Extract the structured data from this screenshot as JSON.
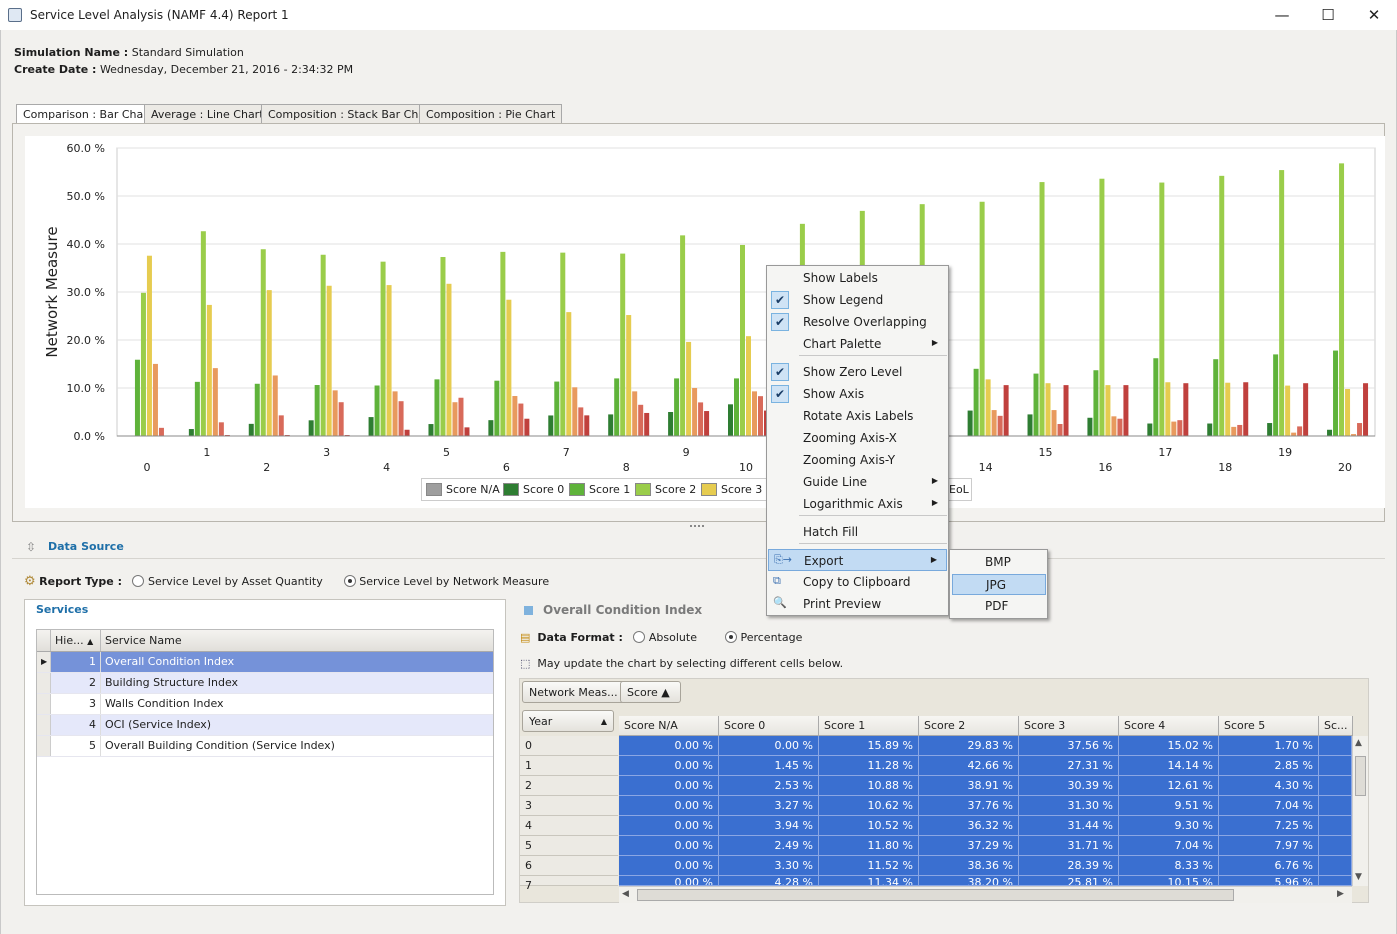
{
  "window": {
    "title": "Service Level Analysis (NAMF 4.4) Report 1",
    "minimize": "—",
    "maximize": "☐",
    "close": "✕"
  },
  "info": {
    "sim_label": "Simulation Name :",
    "sim_value": "Standard Simulation",
    "date_label": "Create Date :",
    "date_value": "Wednesday, December 21, 2016 - 2:34:32 PM"
  },
  "tabs": [
    "Comparison : Bar Chart",
    "Average : Line Chart",
    "Composition : Stack Bar Chart",
    "Composition : Pie Chart"
  ],
  "chart_data": {
    "type": "bar",
    "ylabel": "Network Measure",
    "ylim": [
      0,
      60
    ],
    "yticks": [
      "0.0 %",
      "10.0 %",
      "20.0 %",
      "30.0 %",
      "40.0 %",
      "50.0 %",
      "60.0 %"
    ],
    "categories": [
      "0",
      "1",
      "2",
      "3",
      "4",
      "5",
      "6",
      "7",
      "8",
      "9",
      "10",
      "11",
      "12",
      "13",
      "14",
      "15",
      "16",
      "17",
      "18",
      "19",
      "20"
    ],
    "legend_visible": [
      "Score N/A",
      "Score 0",
      "Score 1",
      "Score 2",
      "Score 3"
    ],
    "legend_tail": "EoL",
    "series": [
      {
        "name": "Score N/A",
        "color": "#9e9e9e",
        "values": [
          0,
          0,
          0,
          0,
          0,
          0,
          0,
          0,
          0,
          0,
          0,
          0,
          0,
          0,
          0,
          0,
          0,
          0,
          0,
          0,
          0
        ]
      },
      {
        "name": "Score 0",
        "color": "#2e7d32",
        "values": [
          0,
          1.45,
          2.53,
          3.27,
          3.94,
          2.49,
          3.3,
          4.28,
          4.5,
          5.0,
          6.6,
          5.5,
          5.5,
          5.5,
          5.3,
          4.5,
          3.8,
          2.6,
          2.6,
          2.7,
          1.3
        ]
      },
      {
        "name": "Score 1",
        "color": "#5fb33a",
        "values": [
          15.89,
          11.28,
          10.88,
          10.62,
          10.52,
          11.8,
          11.52,
          11.34,
          12,
          12,
          12,
          13,
          13,
          13,
          14,
          13,
          13.7,
          16.2,
          16,
          17,
          17.8
        ]
      },
      {
        "name": "Score 2",
        "color": "#9acd4a",
        "values": [
          29.83,
          42.66,
          38.91,
          37.76,
          36.32,
          37.29,
          38.36,
          38.2,
          38,
          41.8,
          39.8,
          44.2,
          46.9,
          48.3,
          48.8,
          52.9,
          53.6,
          52.8,
          54.2,
          55.4,
          56.8
        ]
      },
      {
        "name": "Score 3",
        "color": "#e6cc50",
        "values": [
          37.56,
          27.31,
          30.39,
          31.3,
          31.44,
          31.71,
          28.39,
          25.81,
          25.2,
          19.6,
          20.8,
          14,
          13,
          13,
          11.8,
          11,
          10.6,
          11.2,
          11.1,
          10.5,
          9.8
        ]
      },
      {
        "name": "Score 4",
        "color": "#e89a5e",
        "values": [
          15.02,
          14.14,
          12.61,
          9.51,
          9.3,
          7.04,
          8.33,
          10.15,
          9.3,
          10,
          9.3,
          7,
          6,
          6,
          5.4,
          5.4,
          4.1,
          3,
          1.9,
          0.7,
          0.4
        ]
      },
      {
        "name": "Score 5",
        "color": "#d86a5a",
        "values": [
          1.7,
          2.85,
          4.3,
          7.04,
          7.25,
          7.97,
          6.76,
          5.96,
          6.5,
          7,
          8.3,
          6,
          5,
          5,
          4.2,
          2.5,
          3.6,
          3.3,
          2.3,
          2,
          2.7
        ]
      },
      {
        "name": "EoL",
        "color": "#c0403d",
        "values": [
          0,
          0.2,
          0.2,
          0.2,
          1.3,
          1.8,
          3.6,
          4.3,
          4.8,
          5.2,
          5.3,
          6,
          7,
          8,
          10.6,
          10.6,
          10.6,
          11,
          11.2,
          11,
          11
        ]
      }
    ]
  },
  "context_menu": {
    "items": [
      {
        "label": "Show Labels",
        "checked": false,
        "submenu": false
      },
      {
        "label": "Show Legend",
        "checked": true,
        "submenu": false
      },
      {
        "label": "Resolve Overlapping",
        "checked": true,
        "submenu": false
      },
      {
        "label": "Chart Palette",
        "checked": false,
        "submenu": true
      },
      {
        "label": "Show Zero Level",
        "checked": true,
        "submenu": false
      },
      {
        "label": "Show Axis",
        "checked": true,
        "submenu": false
      },
      {
        "label": "Rotate Axis Labels",
        "checked": false,
        "submenu": false
      },
      {
        "label": "Zooming Axis-X",
        "checked": false,
        "submenu": false
      },
      {
        "label": "Zooming Axis-Y",
        "checked": false,
        "submenu": false
      },
      {
        "label": "Guide Line",
        "checked": false,
        "submenu": true
      },
      {
        "label": "Logarithmic Axis",
        "checked": false,
        "submenu": true
      },
      {
        "label": "Hatch Fill",
        "checked": false,
        "submenu": false
      },
      {
        "label": "Export",
        "checked": false,
        "submenu": true
      },
      {
        "label": "Copy to Clipboard",
        "checked": false,
        "submenu": false
      },
      {
        "label": "Print Preview",
        "checked": false,
        "submenu": false
      }
    ],
    "export_submenu": [
      "BMP",
      "JPG",
      "PDF"
    ]
  },
  "datasource": {
    "title": "Data Source",
    "report_type_label": "Report Type :",
    "option_quantity": "Service Level by Asset Quantity",
    "option_network": "Service Level by Network Measure",
    "services_title": "Services",
    "grid_headers": [
      "Hie...",
      "Service Name"
    ],
    "services": [
      {
        "num": "1",
        "name": "Overall Condition Index"
      },
      {
        "num": "2",
        "name": "Building Structure Index"
      },
      {
        "num": "3",
        "name": "Walls Condition Index"
      },
      {
        "num": "4",
        "name": "OCI (Service Index)"
      },
      {
        "num": "5",
        "name": "Overall Building Condition (Service Index)"
      }
    ]
  },
  "pivot": {
    "title": "Overall Condition Index",
    "format_label": "Data Format :",
    "opt_absolute": "Absolute",
    "opt_percentage": "Percentage",
    "note": "May update the chart by selecting different cells below.",
    "field_network": "Network Meas...",
    "field_score": "Score ▲",
    "field_year": "Year",
    "columns": [
      "Score N/A",
      "Score 0",
      "Score 1",
      "Score 2",
      "Score 3",
      "Score 4",
      "Score 5",
      "Sc..."
    ],
    "rows": [
      {
        "year": "0",
        "cells": [
          "0.00 %",
          "0.00 %",
          "15.89 %",
          "29.83 %",
          "37.56 %",
          "15.02 %",
          "1.70 %"
        ]
      },
      {
        "year": "1",
        "cells": [
          "0.00 %",
          "1.45 %",
          "11.28 %",
          "42.66 %",
          "27.31 %",
          "14.14 %",
          "2.85 %"
        ]
      },
      {
        "year": "2",
        "cells": [
          "0.00 %",
          "2.53 %",
          "10.88 %",
          "38.91 %",
          "30.39 %",
          "12.61 %",
          "4.30 %"
        ]
      },
      {
        "year": "3",
        "cells": [
          "0.00 %",
          "3.27 %",
          "10.62 %",
          "37.76 %",
          "31.30 %",
          "9.51 %",
          "7.04 %"
        ]
      },
      {
        "year": "4",
        "cells": [
          "0.00 %",
          "3.94 %",
          "10.52 %",
          "36.32 %",
          "31.44 %",
          "9.30 %",
          "7.25 %"
        ]
      },
      {
        "year": "5",
        "cells": [
          "0.00 %",
          "2.49 %",
          "11.80 %",
          "37.29 %",
          "31.71 %",
          "7.04 %",
          "7.97 %"
        ]
      },
      {
        "year": "6",
        "cells": [
          "0.00 %",
          "3.30 %",
          "11.52 %",
          "38.36 %",
          "28.39 %",
          "8.33 %",
          "6.76 %"
        ]
      },
      {
        "year": "7",
        "cells": [
          "0.00 %",
          "4.28 %",
          "11.34 %",
          "38.20 %",
          "25.81 %",
          "10.15 %",
          "5.96 %"
        ]
      }
    ]
  }
}
